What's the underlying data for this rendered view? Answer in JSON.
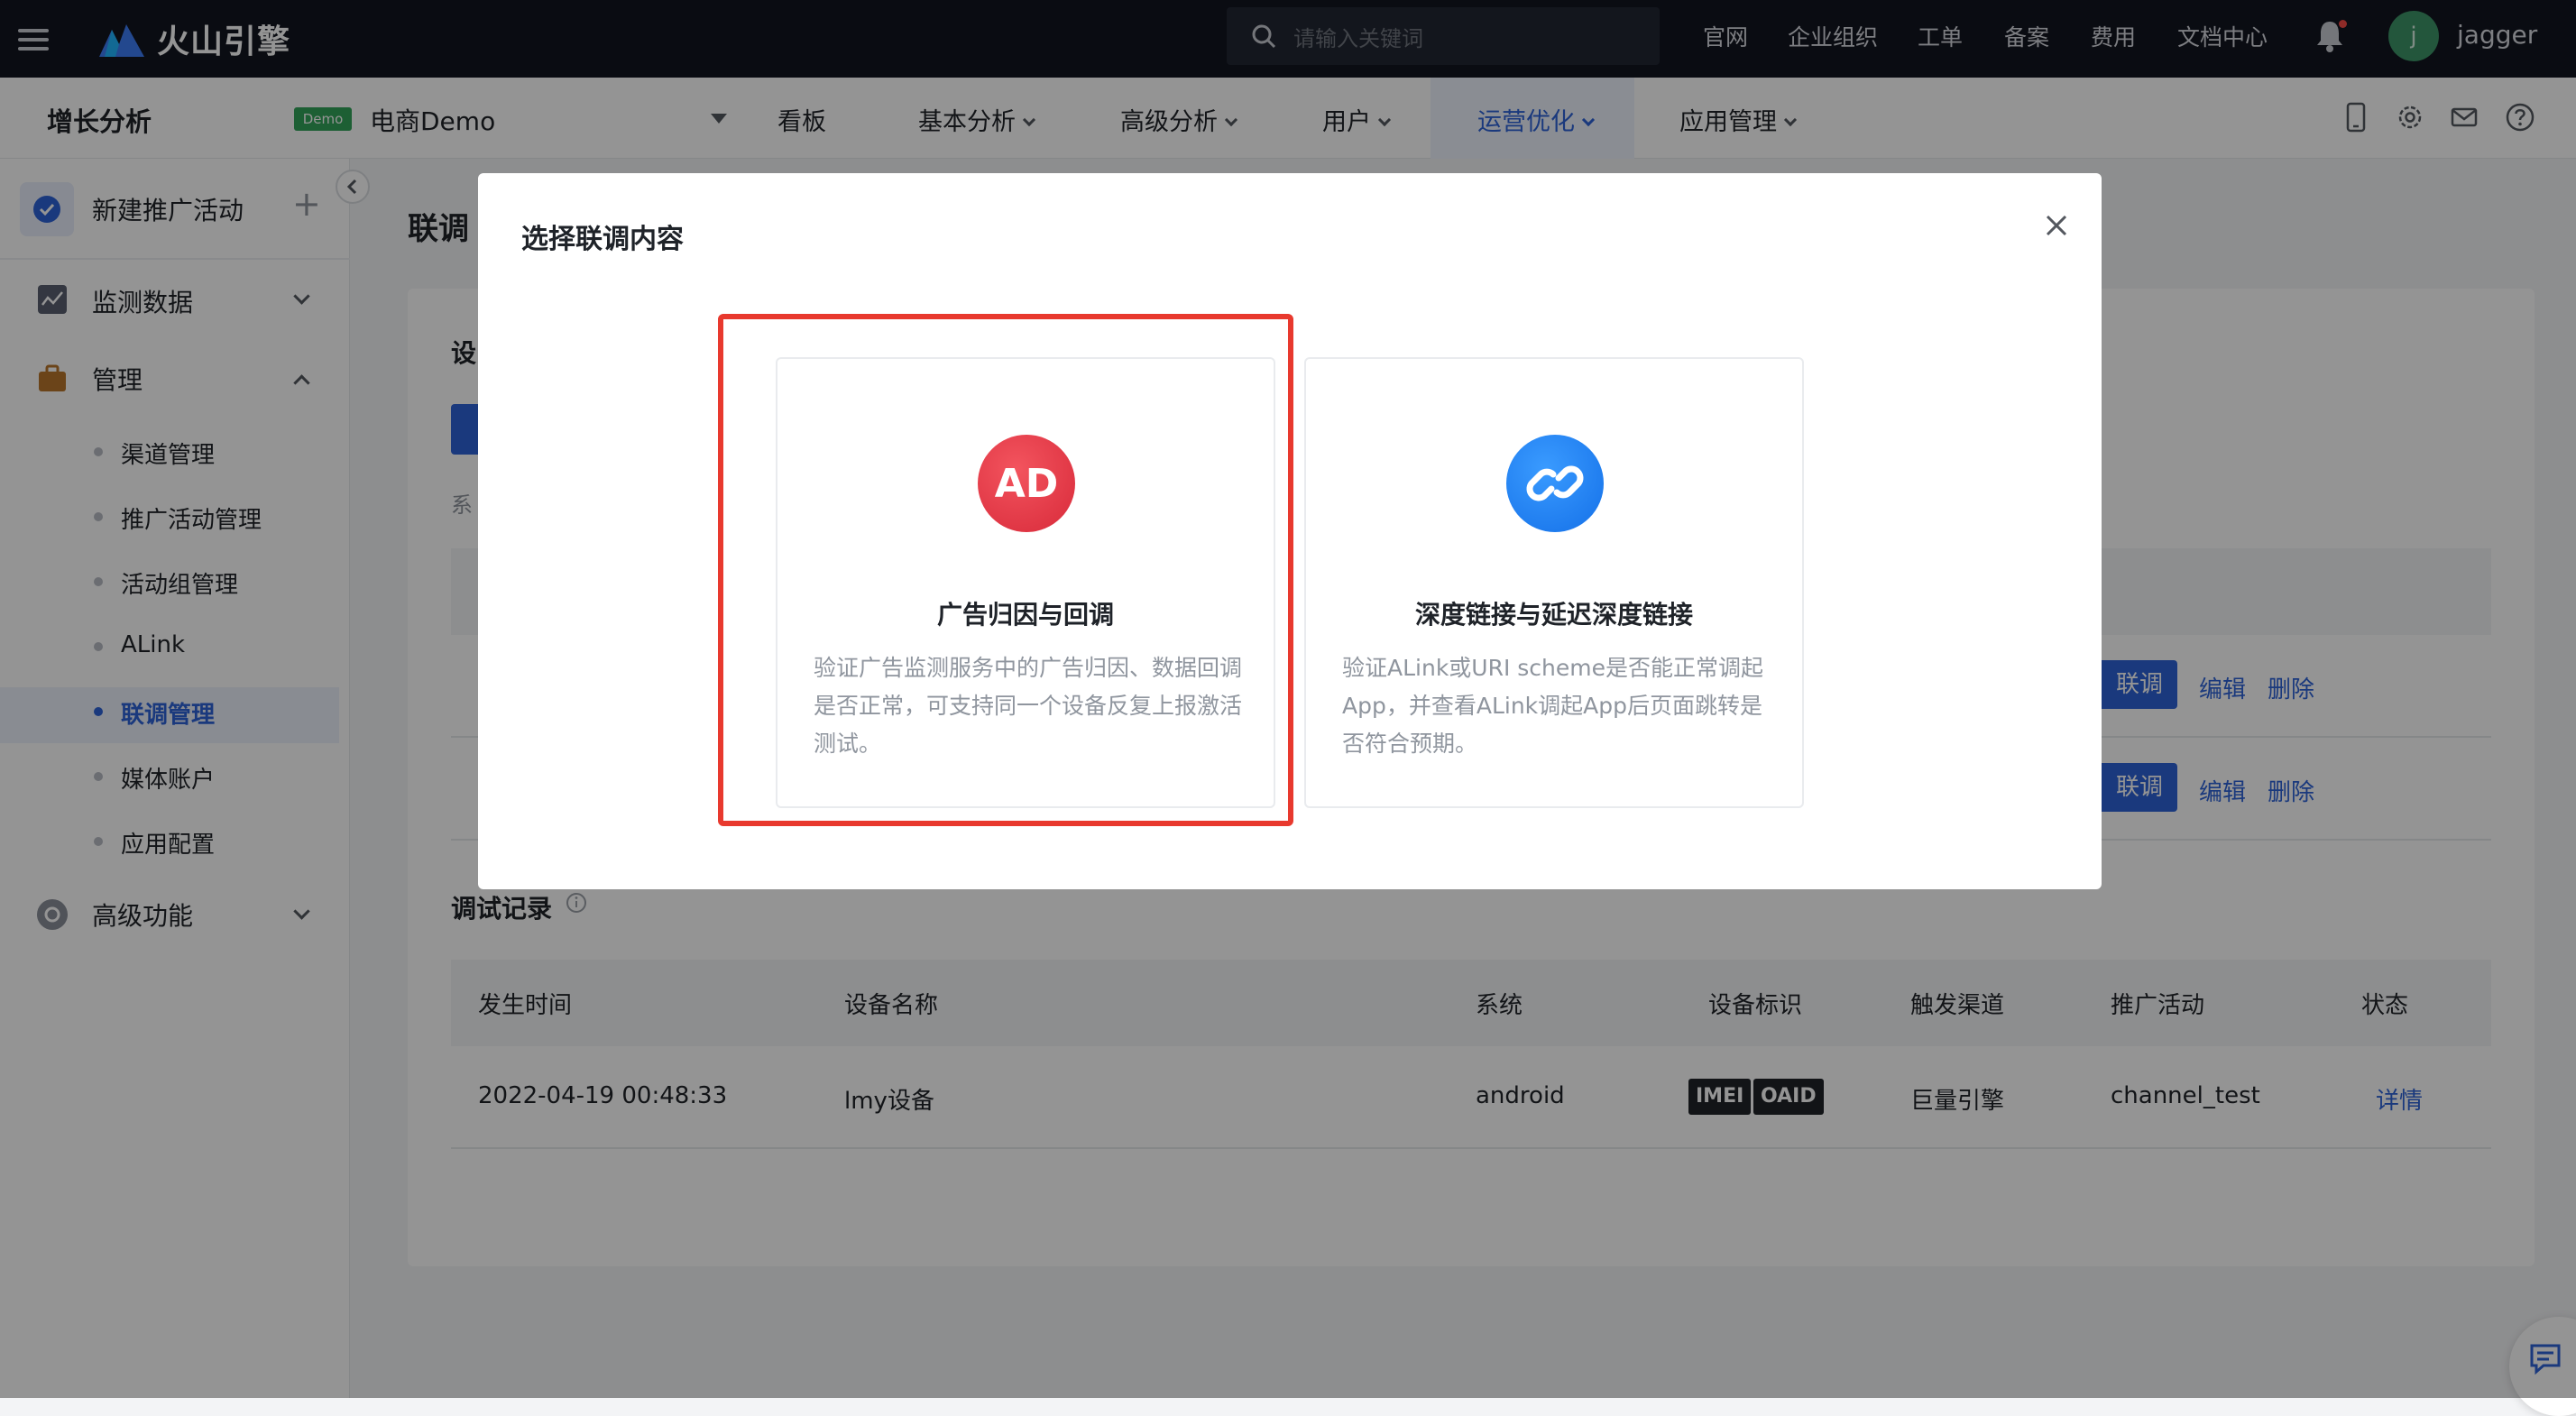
{
  "topbar": {
    "brand": "火山引擎",
    "search_placeholder": "请输入关键词",
    "links": [
      "官网",
      "企业组织",
      "工单",
      "备案",
      "费用",
      "文档中心"
    ],
    "avatar_initial": "j",
    "username": "jagger"
  },
  "subheader": {
    "app_title": "增长分析",
    "demo_badge": "Demo",
    "project": "电商Demo",
    "nav": [
      "看板",
      "基本分析",
      "高级分析",
      "用户",
      "运营优化",
      "应用管理"
    ]
  },
  "sidebar": {
    "new_campaign": "新建推广活动",
    "monitor": "监测数据",
    "manage": "管理",
    "items": [
      "渠道管理",
      "推广活动管理",
      "活动组管理",
      "ALink",
      "联调管理",
      "媒体账户",
      "应用配置"
    ],
    "advanced": "高级功能"
  },
  "content": {
    "page_title_fragment": "联调",
    "section_fragment": "设",
    "system_fragment": "系",
    "row_actions": {
      "joint": "联调",
      "edit": "编辑",
      "delete": "删除"
    },
    "debug_title": "调试记录",
    "columns": [
      "发生时间",
      "设备名称",
      "系统",
      "设备标识",
      "触发渠道",
      "推广活动",
      "状态"
    ],
    "rows": [
      {
        "time": "2022-04-19 00:48:33",
        "device": "lmy设备",
        "os": "android",
        "tags": [
          "IMEI",
          "OAID"
        ],
        "channel": "巨量引擎",
        "campaign": "channel_test",
        "status": "详情"
      }
    ]
  },
  "modal": {
    "title": "选择联调内容",
    "options": [
      {
        "icon_text": "AD",
        "title": "广告归因与回调",
        "desc": "验证广告监测服务中的广告归因、数据回调是否正常，可支持同一个设备反复上报激活测试。"
      },
      {
        "icon_text": "",
        "title": "深度链接与延迟深度链接",
        "desc": "验证ALink或URI scheme是否能正常调起App，并查看ALink调起App后页面跳转是否符合预期。"
      }
    ]
  },
  "colors": {
    "accent": "#2d63d8",
    "ad_red": "#e8313f",
    "link_blue": "#1f7ef0",
    "highlight": "#e8392e"
  }
}
